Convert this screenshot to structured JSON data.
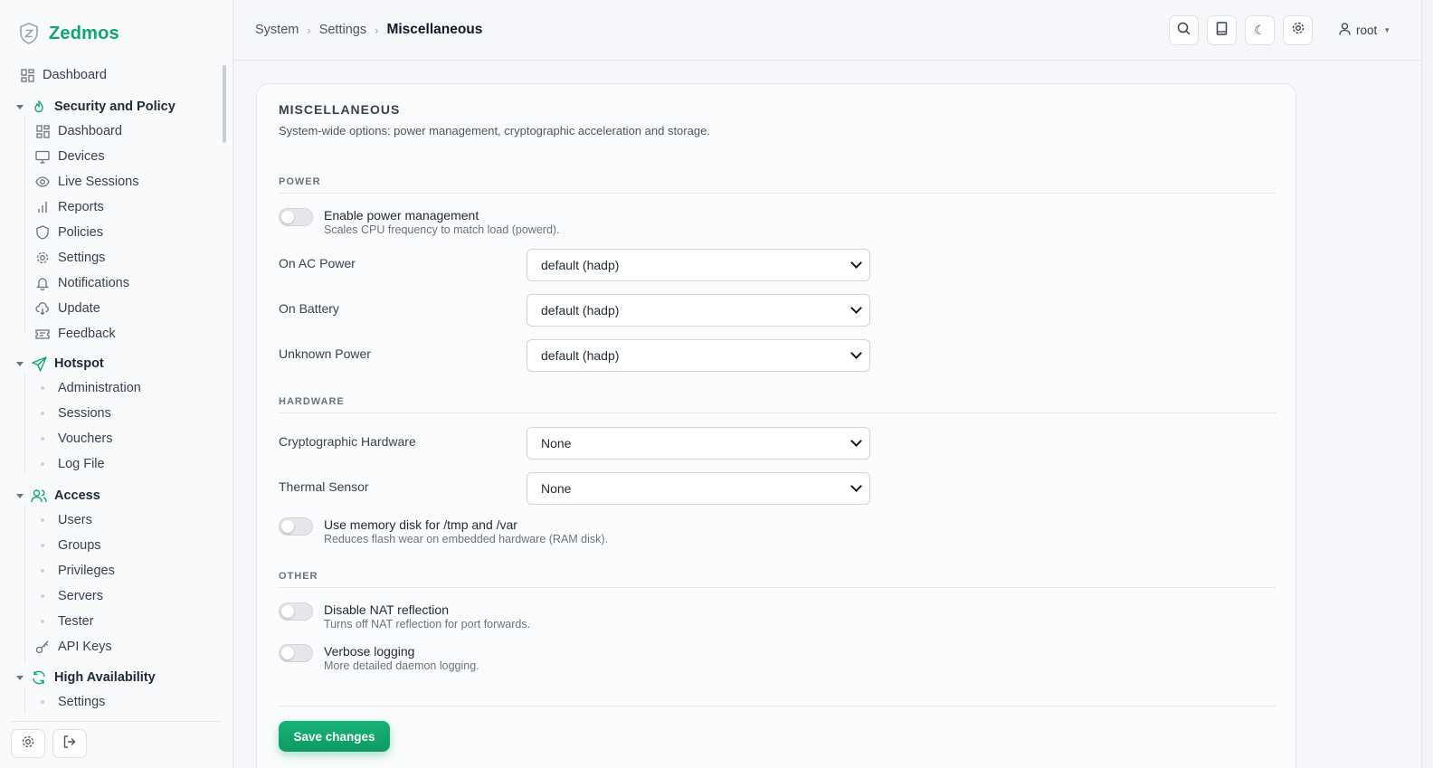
{
  "app": {
    "name": "Zedmos",
    "accent": "#0fa56b"
  },
  "sidebar": {
    "top": {
      "label": "Dashboard",
      "icon": "dashboard-icon"
    },
    "groups": [
      {
        "label": "Security and Policy",
        "icon": "flame-icon",
        "items": [
          {
            "label": "Dashboard",
            "icon": "dashboard-icon"
          },
          {
            "label": "Devices",
            "icon": "monitor-icon"
          },
          {
            "label": "Live Sessions",
            "icon": "eye-icon"
          },
          {
            "label": "Reports",
            "icon": "bar-chart-icon"
          },
          {
            "label": "Policies",
            "icon": "shield-icon"
          },
          {
            "label": "Settings",
            "icon": "gear-icon"
          },
          {
            "label": "Notifications",
            "icon": "bell-icon"
          },
          {
            "label": "Update",
            "icon": "cloud-download-icon"
          },
          {
            "label": "Feedback",
            "icon": "ticket-icon"
          }
        ]
      },
      {
        "label": "Hotspot",
        "icon": "send-icon",
        "items": [
          {
            "label": "Administration"
          },
          {
            "label": "Sessions"
          },
          {
            "label": "Vouchers"
          },
          {
            "label": "Log File"
          }
        ]
      },
      {
        "label": "Access",
        "icon": "users-icon",
        "items": [
          {
            "label": "Users"
          },
          {
            "label": "Groups"
          },
          {
            "label": "Privileges"
          },
          {
            "label": "Servers"
          },
          {
            "label": "Tester"
          },
          {
            "label": "API Keys",
            "icon": "key-icon"
          }
        ]
      },
      {
        "label": "High Availability",
        "icon": "refresh-icon",
        "items": [
          {
            "label": "Settings"
          }
        ]
      }
    ]
  },
  "header": {
    "breadcrumbs": [
      "System",
      "Settings",
      "Miscellaneous"
    ],
    "user": "root"
  },
  "card": {
    "title": "MISCELLANEOUS",
    "subtitle": "System-wide options: power management, cryptographic acceleration and storage.",
    "sections": {
      "power": "POWER",
      "hardware": "HARDWARE",
      "other": "OTHER"
    },
    "power_mgmt": {
      "label": "Enable power management",
      "desc": "Scales CPU frequency to match load (powerd).",
      "enabled": false
    },
    "ac_power": {
      "label": "On AC Power",
      "value": "default (hadp)"
    },
    "battery": {
      "label": "On Battery",
      "value": "default (hadp)"
    },
    "unknown_power": {
      "label": "Unknown Power",
      "value": "default (hadp)"
    },
    "crypto": {
      "label": "Cryptographic Hardware",
      "value": "None"
    },
    "thermal": {
      "label": "Thermal Sensor",
      "value": "None"
    },
    "memdisk": {
      "label": "Use memory disk for /tmp and /var",
      "desc": "Reduces flash wear on embedded hardware (RAM disk).",
      "enabled": false
    },
    "nat": {
      "label": "Disable NAT reflection",
      "desc": "Turns off NAT reflection for port forwards.",
      "enabled": false
    },
    "verbose": {
      "label": "Verbose logging",
      "desc": "More detailed daemon logging.",
      "enabled": false
    },
    "save_label": "Save changes"
  }
}
